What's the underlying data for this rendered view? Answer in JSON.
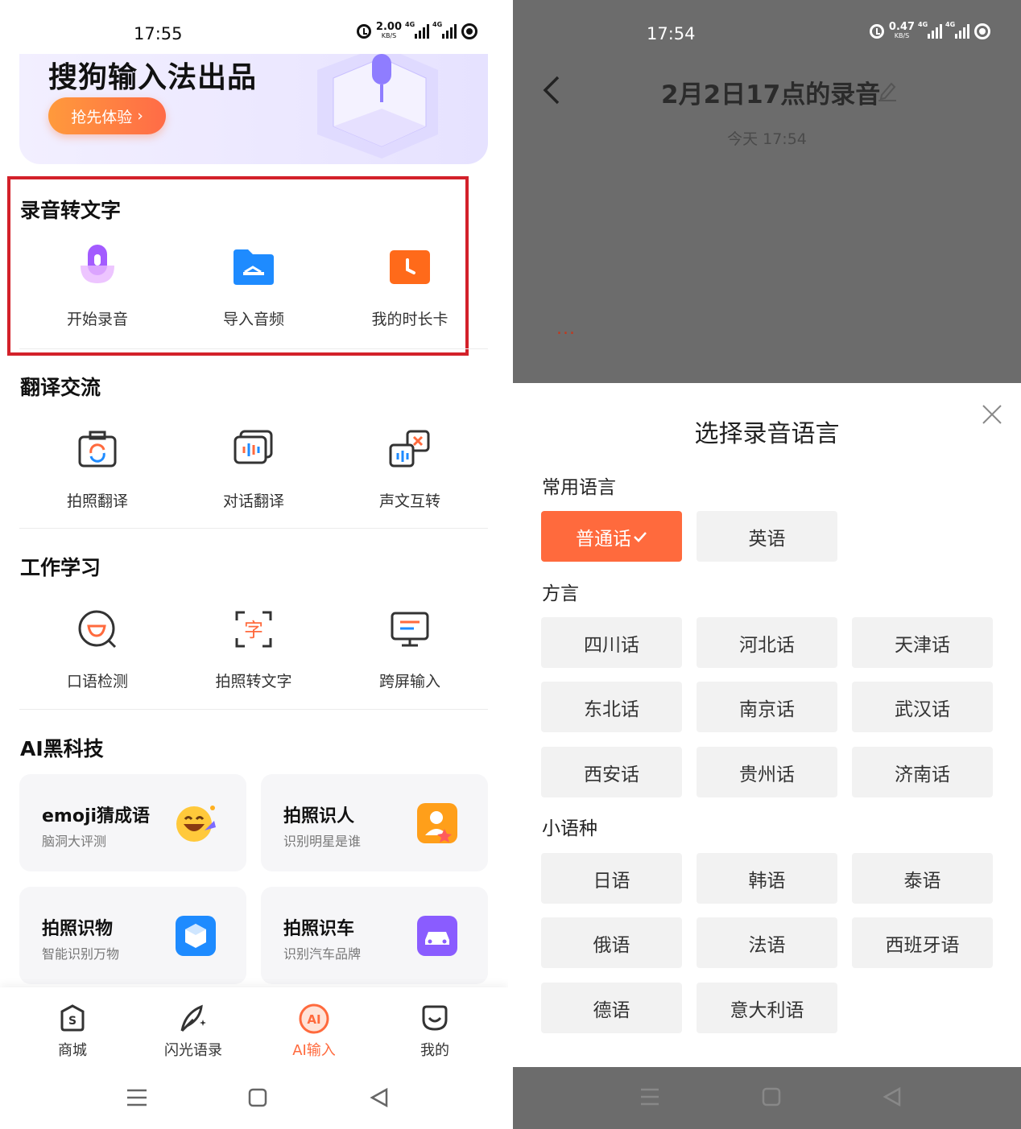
{
  "left": {
    "status": {
      "time": "17:55",
      "net_speed": "2.00",
      "net_unit": "KB/S",
      "net_type1": "4G",
      "net_type2": "4G"
    },
    "banner": {
      "title": "搜狗输入法出品",
      "button": "抢先体验"
    },
    "sections": {
      "record": {
        "title": "录音转文字",
        "items": [
          "开始录音",
          "导入音频",
          "我的时长卡"
        ]
      },
      "translate": {
        "title": "翻译交流",
        "items": [
          "拍照翻译",
          "对话翻译",
          "声文互转"
        ]
      },
      "work": {
        "title": "工作学习",
        "items": [
          "口语检测",
          "拍照转文字",
          "跨屏输入"
        ]
      },
      "ai": {
        "title": "AI黑科技",
        "cards": [
          {
            "title": "emoji猜成语",
            "subtitle": "脑洞大评测"
          },
          {
            "title": "拍照识人",
            "subtitle": "识别明星是谁"
          },
          {
            "title": "拍照识物",
            "subtitle": "智能识别万物"
          },
          {
            "title": "拍照识车",
            "subtitle": "识别汽车品牌"
          }
        ]
      }
    },
    "tabs": [
      "商城",
      "闪光语录",
      "AI输入",
      "我的"
    ],
    "colors": {
      "accent": "#ff6a3d",
      "highlight": "#d3212a"
    }
  },
  "right": {
    "status": {
      "time": "17:54",
      "net_speed": "0.47",
      "net_unit": "KB/S",
      "net_type1": "4G",
      "net_type2": "4G"
    },
    "recording": {
      "title": "2月2日17点的录音",
      "time": "今天 17:54",
      "dots": "..."
    },
    "sheet": {
      "title": "选择录音语言",
      "groups": {
        "common": {
          "title": "常用语言",
          "options": [
            "普通话",
            "英语"
          ],
          "selected": "普通话"
        },
        "dialect": {
          "title": "方言",
          "options": [
            "四川话",
            "河北话",
            "天津话",
            "东北话",
            "南京话",
            "武汉话",
            "西安话",
            "贵州话",
            "济南话"
          ]
        },
        "minor": {
          "title": "小语种",
          "options": [
            "日语",
            "韩语",
            "泰语",
            "俄语",
            "法语",
            "西班牙语",
            "德语",
            "意大利语"
          ]
        }
      }
    }
  }
}
